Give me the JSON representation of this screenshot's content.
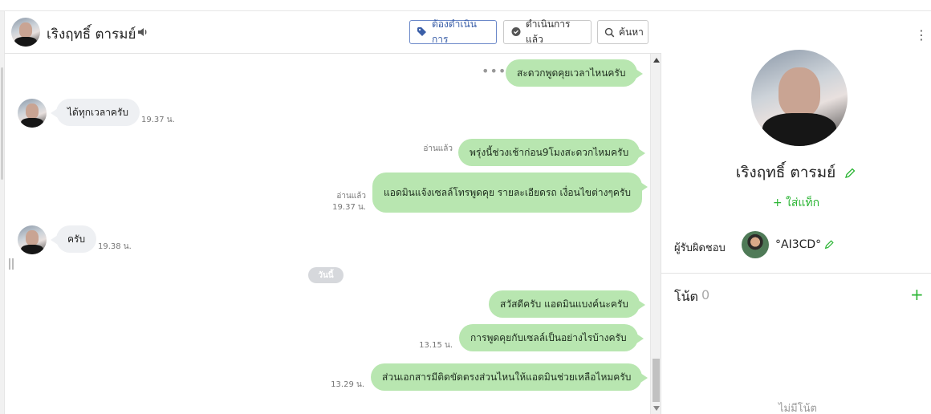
{
  "chat_header": {
    "name": "เริงฤทธิ์ ตารมย์",
    "buttons": {
      "todo": "ต้องดำเนินการ",
      "done": "ดำเนินการแล้ว",
      "search": "ค้นหา"
    }
  },
  "messages": [
    {
      "id": "m1",
      "direction": "out",
      "text": "สะดวกพูดคุยเวลาไหนครับ"
    },
    {
      "id": "m2",
      "direction": "in",
      "text": "ได้ทุกเวลาครับ",
      "time": "19.37 น."
    },
    {
      "id": "m3",
      "direction": "out",
      "text": "พรุ่งนี้ช่วงเช้าก่อน9โมงสะดวกไหมครับ",
      "read": "อ่านแล้ว"
    },
    {
      "id": "m4",
      "direction": "out",
      "text": "แอดมินแจ้งเซลล์โทรพูดคุย รายละเอียดรถ เงื่อนไขต่างๆครับ",
      "read": "อ่านแล้ว",
      "time": "19.37 น."
    },
    {
      "id": "m5",
      "direction": "in",
      "text": "ครับ",
      "time": "19.38 น."
    },
    {
      "id": "m6",
      "direction": "out",
      "text": "สวัสดีครับ แอดมินแบงค์นะครับ"
    },
    {
      "id": "m7",
      "direction": "out",
      "text": "การพูดคุยกับเซลล์เป็นอย่างไรบ้างครับ",
      "time": "13.15 น."
    },
    {
      "id": "m8",
      "direction": "out",
      "text": "ส่วนเอกสารมีติดขัดตรงส่วนไหนให้แอดมินช่วยเหลือไหมครับ",
      "time": "13.29 น."
    }
  ],
  "date_separator": "วันนี้",
  "profile": {
    "name": "เริงฤทธิ์ ตารมย์",
    "add_tag": "+ ใส่แท็ก",
    "responsible_label": "ผู้รับผิดชอบ",
    "responsible_name": "°AI3CD°"
  },
  "notes": {
    "title": "โน้ต",
    "count": "0",
    "add": "+",
    "empty": "ไม่มีโน้ต"
  },
  "colors": {
    "outgoing_bubble": "#b8e6b0",
    "incoming_bubble": "#eef0f3",
    "accent_green": "#2bb534",
    "accent_blue": "#3b5fa8"
  },
  "icons": [
    "speaker-icon",
    "tag-icon",
    "chat-check-icon",
    "search-icon",
    "pencil-icon",
    "kebab-menu-icon"
  ]
}
